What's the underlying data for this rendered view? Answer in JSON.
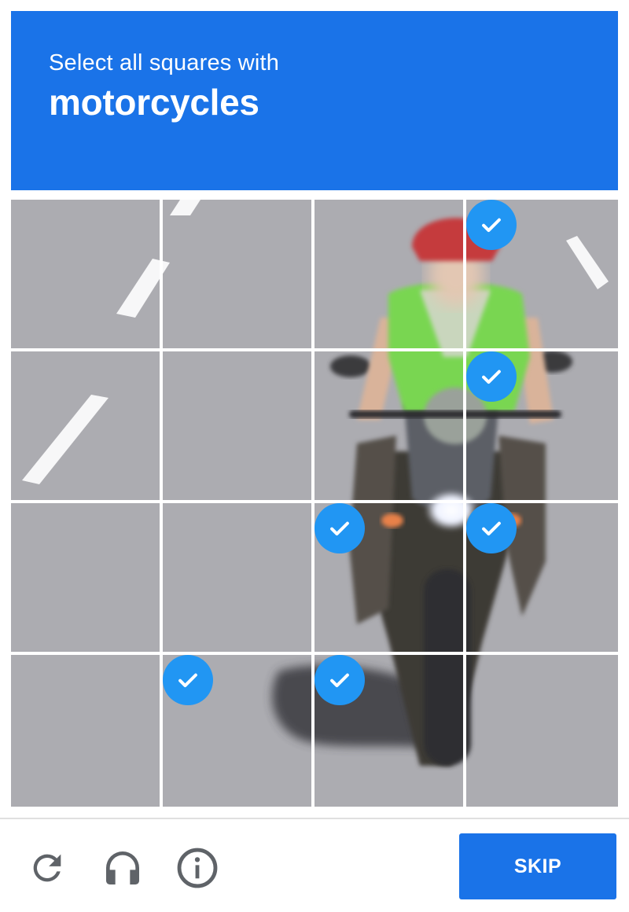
{
  "header": {
    "instruction": "Select all squares with",
    "target": "motorcycles"
  },
  "grid": {
    "rows": 4,
    "columns": 4,
    "selected_tiles": [
      3,
      7,
      10,
      11,
      13,
      14
    ]
  },
  "footer": {
    "reload_icon": "reload-icon",
    "audio_icon": "headphones-icon",
    "info_icon": "info-icon",
    "skip_label": "SKIP"
  },
  "colors": {
    "brand_blue": "#1a73e8",
    "check_blue": "#2196f3",
    "icon_gray": "#5f6368"
  }
}
